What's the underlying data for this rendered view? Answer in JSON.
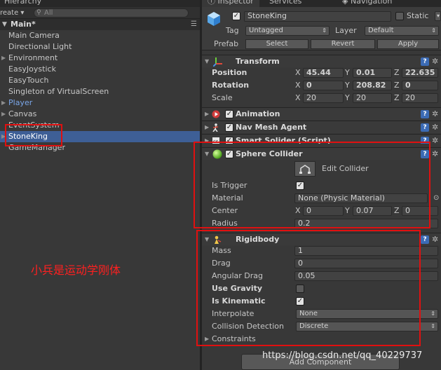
{
  "hierarchy": {
    "tab": "Hierarchy",
    "create": "reate ▾",
    "search_placeholder": "All",
    "scene": "Main*",
    "items": [
      {
        "label": "Main Camera",
        "expandable": false,
        "prefab": false,
        "selected": false
      },
      {
        "label": "Directional Light",
        "expandable": false,
        "prefab": false,
        "selected": false
      },
      {
        "label": "Environment",
        "expandable": true,
        "prefab": false,
        "selected": false
      },
      {
        "label": "EasyJoystick",
        "expandable": false,
        "prefab": false,
        "selected": false
      },
      {
        "label": "EasyTouch",
        "expandable": false,
        "prefab": false,
        "selected": false
      },
      {
        "label": "Singleton of VirtualScreen",
        "expandable": false,
        "prefab": false,
        "selected": false
      },
      {
        "label": "Player",
        "expandable": true,
        "prefab": true,
        "selected": false
      },
      {
        "label": "Canvas",
        "expandable": true,
        "prefab": false,
        "selected": false
      },
      {
        "label": "EventSystem",
        "expandable": false,
        "prefab": false,
        "selected": false
      },
      {
        "label": "StoneKing",
        "expandable": true,
        "prefab": false,
        "selected": true
      },
      {
        "label": "GameManager",
        "expandable": false,
        "prefab": false,
        "selected": false
      }
    ]
  },
  "inspector": {
    "tabs": [
      "Inspector",
      "Services",
      "Navigation"
    ],
    "object_name": "StoneKing",
    "static_label": "Static",
    "tag_label": "Tag",
    "tag_value": "Untagged",
    "layer_label": "Layer",
    "layer_value": "Default",
    "prefab_label": "Prefab",
    "prefab_buttons": [
      "Select",
      "Revert",
      "Apply"
    ],
    "transform": {
      "title": "Transform",
      "rows": [
        {
          "label": "Position",
          "x": "45.44",
          "y": "0.01",
          "z": "22.635"
        },
        {
          "label": "Rotation",
          "x": "0",
          "y": "208.82",
          "z": "0"
        },
        {
          "label": "Scale",
          "x": "20",
          "y": "20",
          "z": "20"
        }
      ]
    },
    "components": [
      "Animation",
      "Nav Mesh Agent",
      "Smart Solider (Script)"
    ],
    "sphere_collider": {
      "title": "Sphere Collider",
      "edit_label": "Edit Collider",
      "is_trigger_label": "Is Trigger",
      "is_trigger": true,
      "material_label": "Material",
      "material_value": "None (Physic Material)",
      "center_label": "Center",
      "center": {
        "x": "0",
        "y": "0.07",
        "z": "0"
      },
      "radius_label": "Radius",
      "radius_value": "0.2"
    },
    "rigidbody": {
      "title": "Rigidbody",
      "mass_label": "Mass",
      "mass": "1",
      "drag_label": "Drag",
      "drag": "0",
      "angular_drag_label": "Angular Drag",
      "angular_drag": "0.05",
      "use_gravity_label": "Use Gravity",
      "use_gravity": false,
      "is_kinematic_label": "Is Kinematic",
      "is_kinematic": true,
      "interpolate_label": "Interpolate",
      "interpolate": "None",
      "collision_label": "Collision Detection",
      "collision": "Discrete",
      "constraints_label": "Constraints"
    },
    "add_component": "Add Component"
  },
  "annotation": "小兵是运动学刚体",
  "watermark": "https://blog.csdn.net/qq_40229737",
  "colors": {
    "selection": "#3e5f96",
    "annotation": "#e01010",
    "prefab_text": "#7aa6e8"
  }
}
